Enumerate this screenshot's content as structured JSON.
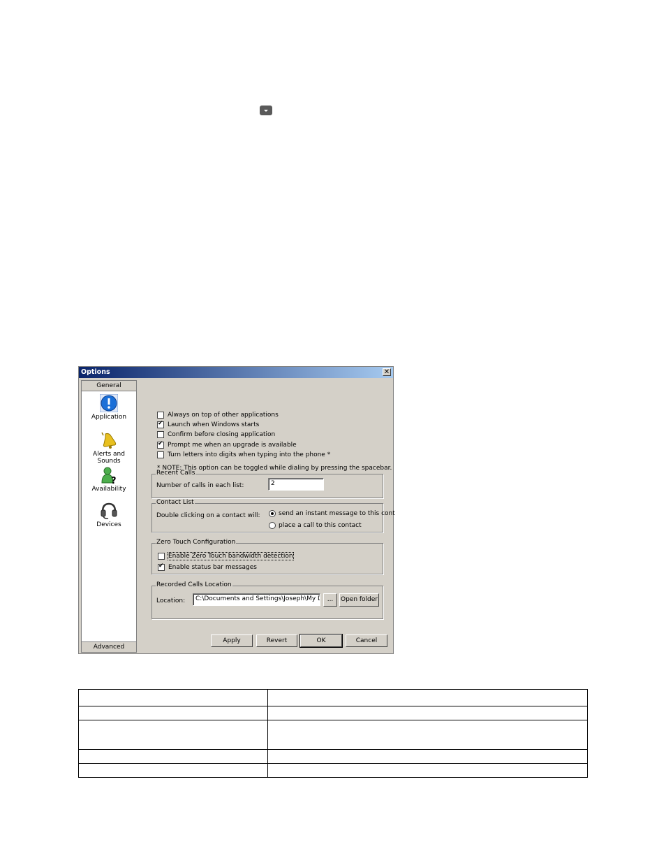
{
  "dialog": {
    "title": "Options",
    "close_label": "✕",
    "sidebar": {
      "top_header": "General",
      "bottom_header": "Advanced",
      "items": [
        {
          "label": "Application",
          "icon": "info-icon"
        },
        {
          "label": "Alerts and Sounds",
          "icon": "bell-icon"
        },
        {
          "label": "Availability",
          "icon": "user-question-icon"
        },
        {
          "label": "Devices",
          "icon": "headset-icon"
        }
      ]
    },
    "general": {
      "options": [
        {
          "label": "Always on top of other applications",
          "checked": false
        },
        {
          "label": "Launch when Windows starts",
          "checked": true
        },
        {
          "label": "Confirm before closing application",
          "checked": false
        },
        {
          "label": "Prompt me when an upgrade is available",
          "checked": true
        },
        {
          "label": "Turn letters into digits when typing into the phone *",
          "checked": false
        }
      ],
      "note": "* NOTE: This option can be toggled while dialing by pressing the spacebar."
    },
    "recent_calls": {
      "legend": "Recent Calls",
      "label": "Number of calls in each list:",
      "value": "2"
    },
    "contact_list": {
      "legend": "Contact List",
      "label": "Double clicking on a contact will:",
      "options": [
        {
          "label": "send an instant message to this cont",
          "selected": true
        },
        {
          "label": "place a call to this contact",
          "selected": false
        }
      ]
    },
    "zero_touch": {
      "legend": "Zero Touch Configuration",
      "options": [
        {
          "label": "Enable Zero Touch bandwidth detection",
          "checked": false
        },
        {
          "label": "Enable status bar messages",
          "checked": true
        }
      ]
    },
    "recorded_calls": {
      "legend": "Recorded Calls Location",
      "label": "Location:",
      "value": "C:\\Documents and Settings\\Joseph\\My Docum",
      "browse_label": "...",
      "open_folder_label": "Open folder"
    },
    "buttons": {
      "apply": "Apply",
      "revert": "Revert",
      "ok": "OK",
      "cancel": "Cancel"
    }
  }
}
